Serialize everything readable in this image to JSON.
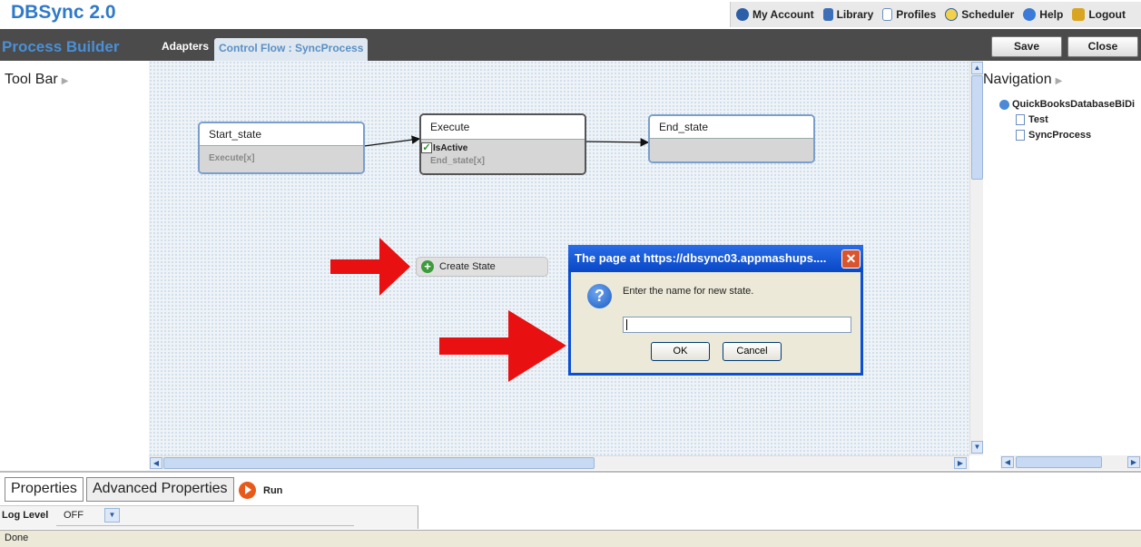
{
  "app": {
    "title": "DBSync 2.0"
  },
  "top_nav": [
    {
      "label": "My Account",
      "icon": "globe-icon"
    },
    {
      "label": "Library",
      "icon": "book-icon"
    },
    {
      "label": "Profiles",
      "icon": "document-icon"
    },
    {
      "label": "Scheduler",
      "icon": "clock-icon"
    },
    {
      "label": "Help",
      "icon": "help-icon"
    },
    {
      "label": "Logout",
      "icon": "lock-icon"
    }
  ],
  "header": {
    "section_title": "Process Builder",
    "tabs": [
      {
        "label": "Adapters",
        "active": false
      },
      {
        "label": "Control Flow : SyncProcess",
        "active": true
      }
    ],
    "save_label": "Save",
    "close_label": "Close"
  },
  "toolbar_panel": {
    "title": "Tool Bar"
  },
  "navigation": {
    "title": "Navigation",
    "tree": {
      "root": "QuickBooksDatabaseBiDi",
      "children": [
        "Test",
        "SyncProcess"
      ]
    }
  },
  "canvas": {
    "states": [
      {
        "name": "Start_state",
        "transitions": [
          "Execute[x]"
        ]
      },
      {
        "name": "Execute",
        "checkbox_label": "IsActive",
        "checked": true,
        "transitions": [
          "End_state[x]"
        ]
      },
      {
        "name": "End_state",
        "transitions": []
      }
    ],
    "create_state_label": "Create State"
  },
  "dialog": {
    "title": "The page at https://dbsync03.appmashups....",
    "message": "Enter the name for new state.",
    "input_value": "",
    "ok_label": "OK",
    "cancel_label": "Cancel"
  },
  "bottom": {
    "tabs": [
      {
        "label": "Properties",
        "selected": false
      },
      {
        "label": "Advanced Properties",
        "selected": true
      }
    ],
    "run_label": "Run",
    "log_level_label": "Log Level",
    "log_level_value": "OFF"
  },
  "status_bar": {
    "text": "Done"
  },
  "colors": {
    "brand": "#2f79c9",
    "header_bar": "#4b4b4b",
    "dialog_title": "#0a4fd6",
    "arrow": "#e81010"
  }
}
